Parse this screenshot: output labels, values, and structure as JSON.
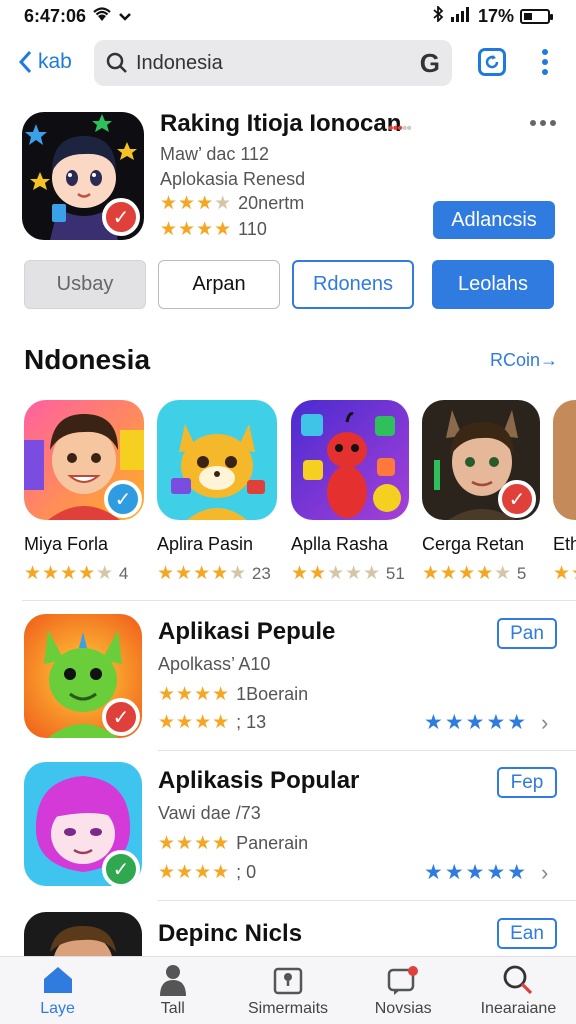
{
  "status": {
    "time": "6:47:06",
    "battery": "17%"
  },
  "topbar": {
    "back_label": "kab",
    "search_value": "Indonesia",
    "g_label": "G"
  },
  "featured": {
    "title": "Raking Itioja Ionocan",
    "line1": "Maw’ dac 112",
    "line2": "Aplokasia Renesd",
    "rating1_text": "20nertm",
    "rating2_text": "110",
    "action_label": "Adlancsis"
  },
  "pills": [
    {
      "label": "Usbay"
    },
    {
      "label": "Arpan"
    },
    {
      "label": "Rdonens"
    },
    {
      "label": "Leolahs"
    }
  ],
  "section": {
    "title": "Ndonesia",
    "see_all": "RCoin→"
  },
  "carousel": [
    {
      "name": "Miya Forla",
      "rating": "4"
    },
    {
      "name": "Aplira Pasin",
      "rating": "23"
    },
    {
      "name": "Aplla Rasha",
      "rating": "51"
    },
    {
      "name": "Cerga Retan",
      "rating": "5"
    },
    {
      "name": "Eth",
      "rating": ""
    }
  ],
  "list": [
    {
      "title": "Aplikasi Pepule",
      "sub": "Apolkass’ A10",
      "r1": "1Boerain",
      "r2": "; 13",
      "btn": "Pan"
    },
    {
      "title": "Aplikasis Popular",
      "sub": "Vawi dae /73",
      "r1": "Panerain",
      "r2": "; 0",
      "btn": "Fep"
    },
    {
      "title": "Depinc Nicls",
      "sub": "",
      "r1": "",
      "r2": "",
      "btn": "Ean"
    }
  ],
  "tabs": [
    {
      "label": "Laye",
      "icon": "home-icon"
    },
    {
      "label": "Tall",
      "icon": "person-icon"
    },
    {
      "label": "Simermaits",
      "icon": "map-icon"
    },
    {
      "label": "Novsias",
      "icon": "notification-icon"
    },
    {
      "label": "Inearaiane",
      "icon": "search-icon"
    }
  ],
  "colors": {
    "accent": "#2f7be0",
    "star": "#f5a623",
    "badge_red": "#e0403a",
    "badge_green": "#2fa84f"
  }
}
